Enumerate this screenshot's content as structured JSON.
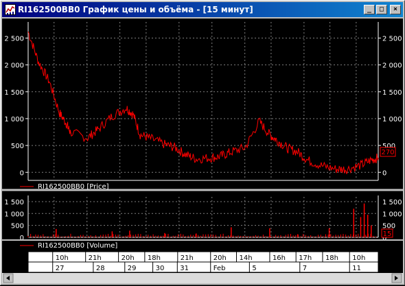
{
  "window": {
    "title": "RI162500BB0 График цены и объёма - [15 минут]",
    "controls": {
      "minimize": "_",
      "maximize": "□",
      "close": "×"
    }
  },
  "colors": {
    "series": "#ff0000",
    "grid": "#808080",
    "text": "#ffffff",
    "background": "#000000"
  },
  "price_panel": {
    "y_ticks": [
      "2 500",
      "2 000",
      "1 500",
      "1 000",
      "500",
      "0"
    ],
    "last_value": "270",
    "legend": "RI162500BB0 [Price]"
  },
  "volume_panel": {
    "y_ticks": [
      "1 500",
      "1 000",
      "500",
      "0"
    ],
    "last_value": "15",
    "legend": "RI162500BB0 [Volume]"
  },
  "time_axis": {
    "hours": [
      "10h",
      "21h",
      "20h",
      "18h",
      "21h",
      "20h",
      "14h",
      "16h",
      "17h",
      "18h",
      "10h"
    ],
    "days": [
      "27",
      "28",
      "29",
      "30",
      "31",
      "Feb",
      "5",
      "7",
      "11"
    ]
  },
  "chart_data": [
    {
      "type": "line",
      "x": [
        0,
        0.03,
        0.06,
        0.09,
        0.11,
        0.12,
        0.17,
        0.2,
        0.24,
        0.28,
        0.3,
        0.32,
        0.35,
        0.39,
        0.42,
        0.45,
        0.48,
        0.52,
        0.55,
        0.58,
        0.62,
        0.66,
        0.69,
        0.71,
        0.74,
        0.77,
        0.8,
        0.84,
        0.88,
        0.91,
        0.95,
        0.98,
        1.0
      ],
      "series": [
        {
          "name": "RI162500BB0 [Price]",
          "values": [
            2620,
            2050,
            1700,
            1100,
            900,
            750,
            640,
            800,
            1050,
            1200,
            1080,
            700,
            630,
            520,
            460,
            330,
            250,
            270,
            300,
            380,
            460,
            950,
            700,
            600,
            450,
            380,
            220,
            120,
            60,
            60,
            130,
            230,
            270
          ]
        }
      ],
      "ylim": [
        -150,
        2800
      ]
    },
    {
      "type": "bar",
      "x": [
        0.08,
        0.24,
        0.29,
        0.39,
        0.48,
        0.58,
        0.69,
        0.77,
        0.86,
        0.93,
        0.95,
        0.96,
        0.97,
        0.98
      ],
      "series": [
        {
          "name": "RI162500BB0 [Volume]",
          "values": [
            350,
            250,
            280,
            180,
            160,
            420,
            380,
            130,
            380,
            1200,
            850,
            1420,
            950,
            500
          ]
        }
      ],
      "ylim": [
        0,
        1700
      ]
    }
  ]
}
